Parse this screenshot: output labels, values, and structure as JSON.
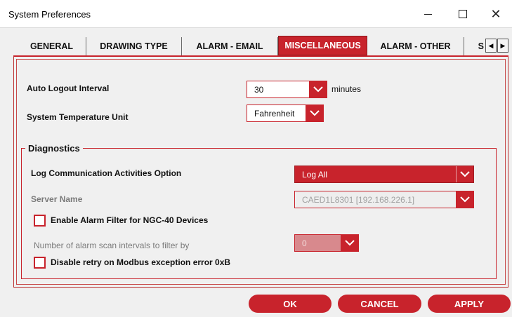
{
  "window": {
    "title": "System Preferences"
  },
  "tabs": [
    {
      "label": "GENERAL"
    },
    {
      "label": "DRAWING TYPE"
    },
    {
      "label": "ALARM - EMAIL"
    },
    {
      "label": "MISCELLANEOUS"
    },
    {
      "label": "ALARM - OTHER"
    },
    {
      "label": "S"
    }
  ],
  "settings": {
    "auto_logout_label": "Auto Logout Interval",
    "auto_logout_value": "30",
    "auto_logout_unit": "minutes",
    "temp_unit_label": "System Temperature Unit",
    "temp_unit_value": "Fahrenheit"
  },
  "diagnostics": {
    "title": "Diagnostics",
    "log_option_label": "Log Communication Activities Option",
    "log_option_value": "Log All",
    "server_name_label": "Server Name",
    "server_name_value": "CAED1L8301 [192.168.226.1]",
    "alarm_filter_label": "Enable Alarm Filter for NGC-40 Devices",
    "alarm_filter_checked": false,
    "scan_intervals_label": "Number of alarm scan intervals to filter by",
    "scan_intervals_value": "0",
    "disable_retry_label": "Disable retry on Modbus exception error 0xB",
    "disable_retry_checked": false
  },
  "buttons": {
    "ok": "OK",
    "cancel": "CANCEL",
    "apply": "APPLY"
  },
  "colors": {
    "accent": "#c8232c",
    "background": "#f0f0f0"
  }
}
